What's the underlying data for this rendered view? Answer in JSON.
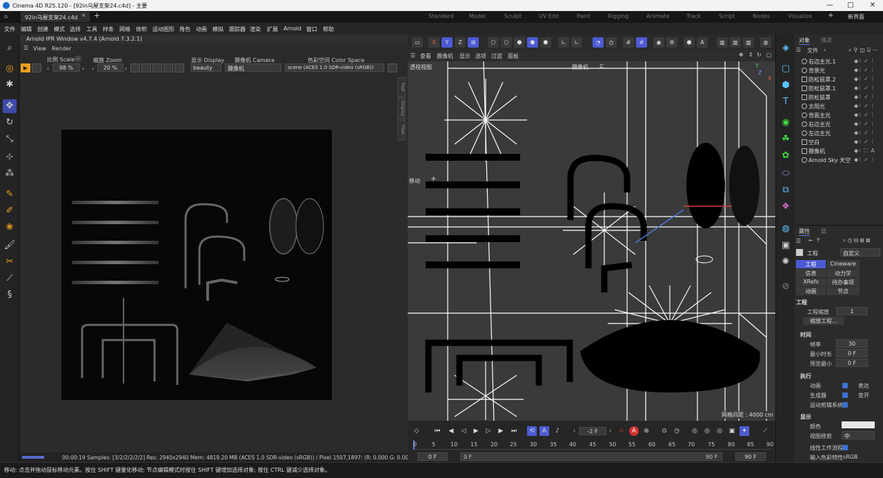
{
  "app": {
    "title": "Cinema 4D R25.120 - [92in乌屋支架24.c4d] - 主要",
    "doc_tab": "92in乌屋支架24.c4d",
    "new_layout": "新界面"
  },
  "layouts": [
    "Standard",
    "Model",
    "Sculpt",
    "UV Edit",
    "Paint",
    "Rigging",
    "Animate",
    "Track",
    "Script",
    "Nodes",
    "Visualize"
  ],
  "menu": [
    "文件",
    "编辑",
    "创建",
    "模式",
    "选择",
    "工具",
    "样条",
    "网格",
    "体积",
    "运动图形",
    "角色",
    "动画",
    "模拟",
    "跟踪器",
    "渲染",
    "扩展",
    "Arnold",
    "窗口",
    "帮助"
  ],
  "ipr": {
    "title": "Arnold IPR Window v4.7.4 (Arnold 7.3.2.1)",
    "menu": [
      "View",
      "Render"
    ],
    "scale_label": "比例 Scale",
    "scale_value": "98 %",
    "zoom_label": "缩放 Zoom",
    "zoom_value": "20 %",
    "display_label": "显示 Display",
    "display_value": "beauty",
    "camera_label": "摄像机 Camera",
    "camera_value": "摄像机",
    "colorspace_label": "色彩空间 Color Space",
    "colorspace_value": "scene (ACES 1.0 SDR-video (sRGB))",
    "side_tabs": [
      "Post",
      "Display",
      "Pixel"
    ],
    "status": "00:00:19  Samples: [3/2/2/2/2/2]  Res: 2940x2940  Mem: 4819.20 MB  (ACES 1.0 SDR-video (sRGB)) / Pixel 1507,1897: (R: 0.000 G: 0.000 B: 0.0"
  },
  "viewport": {
    "menu": [
      "查看",
      "摄像机",
      "显示",
      "选项",
      "过滤",
      "面板"
    ],
    "name": "透视视图",
    "camera": "摄像机",
    "move_label": "移动",
    "grid": "网格间距 : 4000 cm",
    "axis": {
      "y": "Y",
      "z": "Z",
      "x": "X"
    },
    "toolbar": [
      "X",
      "Y",
      "Z"
    ]
  },
  "timeline": {
    "frame_field": "-2 F",
    "ruler": [
      "0",
      "5",
      "10",
      "15",
      "20",
      "25",
      "30",
      "35",
      "40",
      "45",
      "50",
      "55",
      "60",
      "65",
      "70",
      "75",
      "80",
      "85",
      "90"
    ],
    "start": "0 F",
    "start2": "0 F",
    "end": "90 F",
    "end2": "90 F"
  },
  "objects": {
    "tabs": [
      "对象",
      "场次"
    ],
    "menu": [
      "文件"
    ],
    "items": [
      "右边主光.1",
      "背景光",
      "防松鼠罩.2",
      "防松鼠罩.1",
      "防松鼠罩",
      "太阳光",
      "背面主光",
      "右边主光",
      "左边主光",
      "空白",
      "摄像机",
      "Arnold Sky 天空"
    ]
  },
  "attributes": {
    "tabs": [
      "属性",
      "层"
    ],
    "header": "工程",
    "mode": "自定义",
    "buttons": [
      "工程",
      "Cineware",
      "信息",
      "动力学",
      "XRefs",
      "待办事项",
      "动画",
      "节点"
    ],
    "section": "工程",
    "scale_label": "工程缩放",
    "scale_value": "1",
    "scale_btn": "缩放工程...",
    "time_section": "时间",
    "fps_label": "帧率",
    "fps_value": "30",
    "mintime_label": "最小时长",
    "mintime_value": "0 F",
    "preview_label": "预览最小",
    "preview_value": "0 F",
    "exec_section": "执行",
    "anim_label": "动画",
    "anim_extra": "表达",
    "gen_label": "生成器",
    "gen_extra": "变开",
    "mograph_label": "运动剪辑系统",
    "display_section": "显示",
    "color_label": "颜色",
    "clip_label": "视图修剪",
    "clip_value": "中",
    "linear_label": "线性工作流程",
    "input_label": "输入色彩特性",
    "input_value": "sRGB"
  },
  "status_bar": "移动: 点击并拖动鼠标移动元素。按住 SHIFT 键量化移动; 节点编辑模式时按住 SHIFT 键增加选择对象; 按住 CTRL 键减少选择对象。",
  "colors": {
    "accent": "#5b7de8",
    "active_tool": "#4c5bd4",
    "play": "#f0a020",
    "record": "#d03030"
  }
}
